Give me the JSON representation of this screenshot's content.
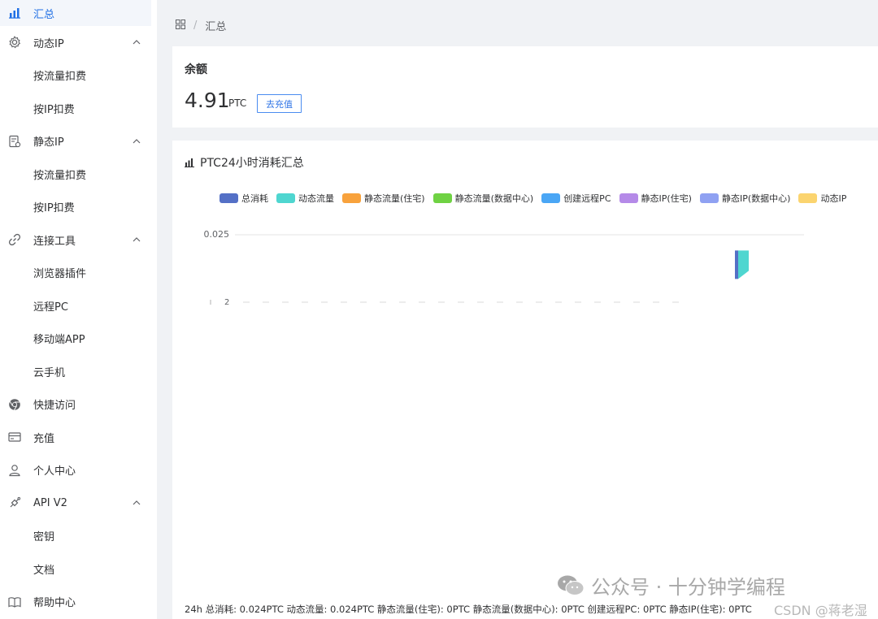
{
  "sidebar": {
    "items": [
      {
        "label": "汇总",
        "icon": "bar-chart-icon",
        "active": true
      },
      {
        "label": "动态IP",
        "icon": "gear-icon",
        "expandable": true
      },
      {
        "label": "按流量扣费",
        "sub": true
      },
      {
        "label": "按IP扣费",
        "sub": true
      },
      {
        "label": "静态IP",
        "icon": "server-icon",
        "expandable": true
      },
      {
        "label": "按流量扣费",
        "sub": true
      },
      {
        "label": "按IP扣费",
        "sub": true
      },
      {
        "label": "连接工具",
        "icon": "link-icon",
        "expandable": true
      },
      {
        "label": "浏览器插件",
        "sub": true
      },
      {
        "label": "远程PC",
        "sub": true
      },
      {
        "label": "移动端APP",
        "sub": true
      },
      {
        "label": "云手机",
        "sub": true
      },
      {
        "label": "快捷访问",
        "icon": "chrome-icon"
      },
      {
        "label": "充值",
        "icon": "card-icon"
      },
      {
        "label": "个人中心",
        "icon": "user-icon"
      },
      {
        "label": "API V2",
        "icon": "plug-icon",
        "expandable": true
      },
      {
        "label": "密钥",
        "sub": true
      },
      {
        "label": "文档",
        "sub": true
      },
      {
        "label": "帮助中心",
        "icon": "book-icon"
      }
    ]
  },
  "breadcrumb": {
    "icon": "grid-icon",
    "current": "汇总"
  },
  "balance": {
    "title": "余额",
    "amount": "4.91",
    "unit": "PTC",
    "recharge_label": "去充值"
  },
  "chart_card": {
    "title": "PTC24小时消耗汇总",
    "summary": "24h 总消耗: 0.024PTC 动态流量: 0.024PTC 静态流量(住宅): 0PTC 静态流量(数据中心): 0PTC 创建远程PC: 0PTC 静态IP(住宅): 0PTC"
  },
  "chart_data": {
    "type": "bar",
    "legend": [
      {
        "name": "总消耗",
        "color": "#5470c6"
      },
      {
        "name": "动态流量",
        "color": "#4fd6d0"
      },
      {
        "name": "静态流量(住宅)",
        "color": "#f8a23c"
      },
      {
        "name": "静态流量(数据中心)",
        "color": "#6fd243"
      },
      {
        "name": "创建远程PC",
        "color": "#4aa6f5"
      },
      {
        "name": "静态IP(住宅)",
        "color": "#b58ae8"
      },
      {
        "name": "静态IP(数据中心)",
        "color": "#8fa1f2"
      },
      {
        "name": "动态IP",
        "color": "#fbd46f"
      }
    ],
    "y_tick_labels": [
      "0.025",
      "2"
    ],
    "series": [
      {
        "name": "总消耗",
        "values": [
          0.024
        ]
      },
      {
        "name": "动态流量",
        "values": [
          0.024
        ]
      }
    ],
    "ylim": [
      0,
      0.025
    ]
  },
  "watermark": {
    "text": "公众号 · 十分钟学编程",
    "sub": "CSDN @蒋老湿"
  }
}
